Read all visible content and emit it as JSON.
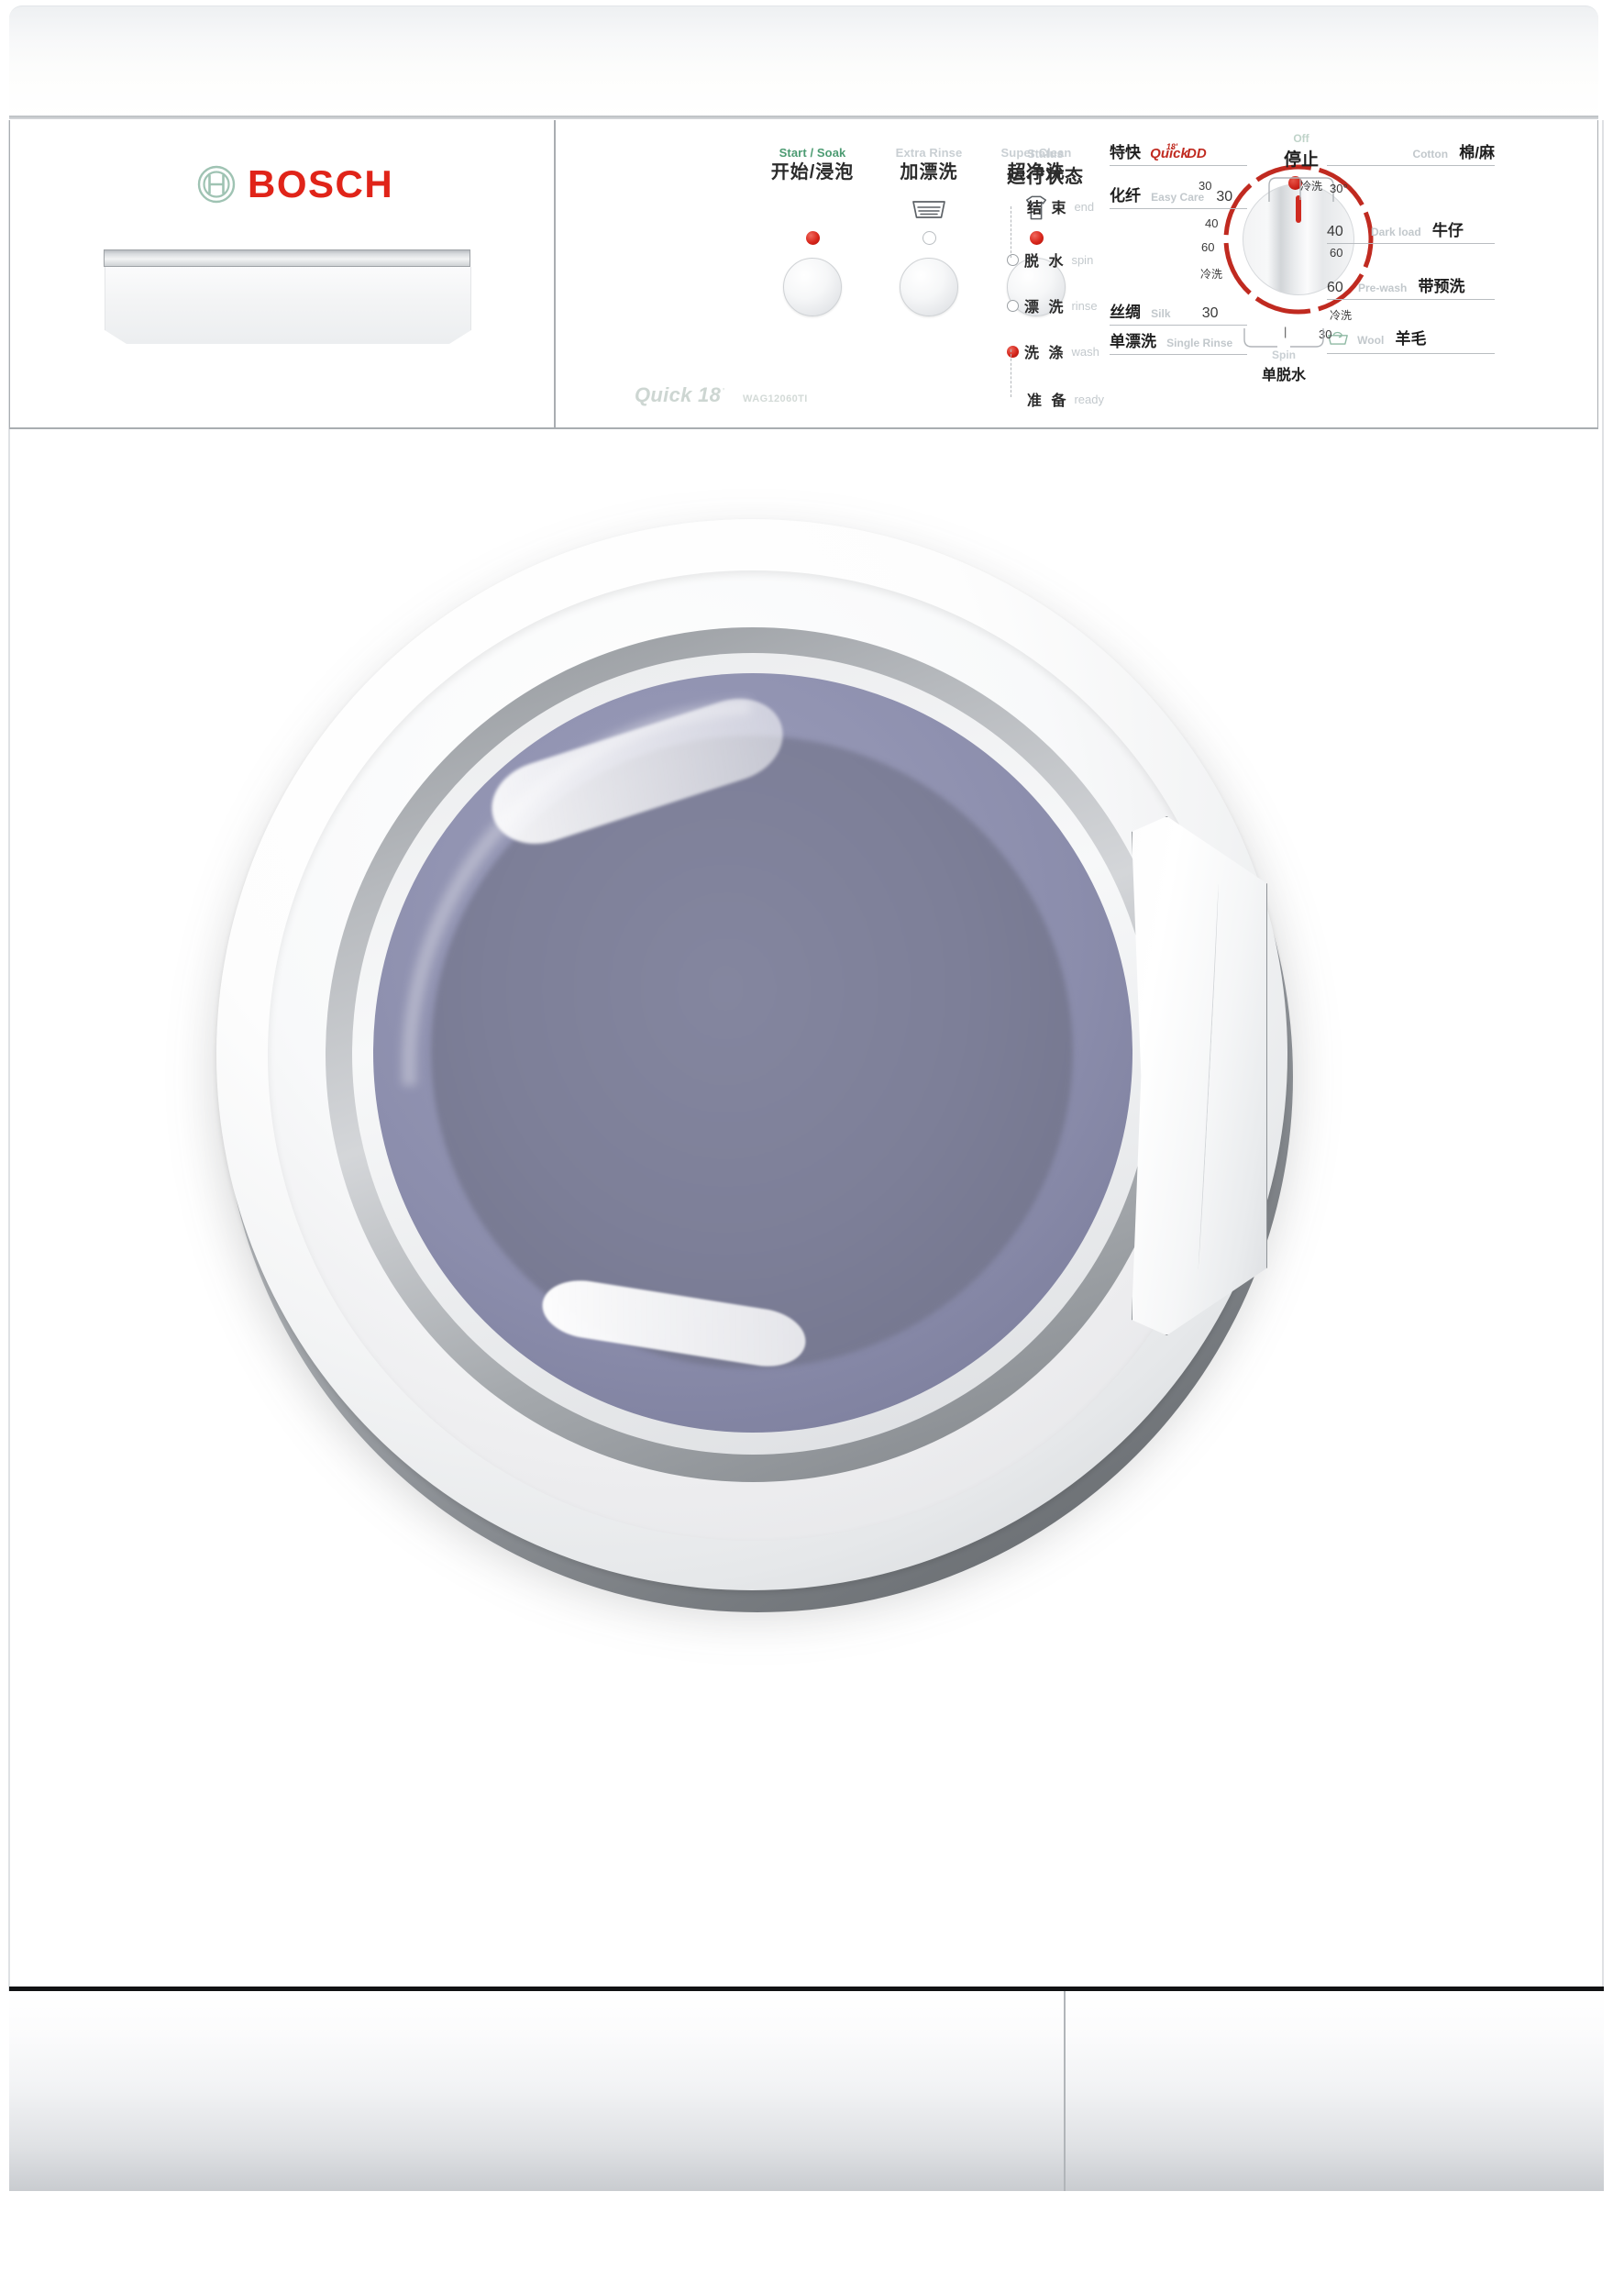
{
  "brand": {
    "name": "BOSCH",
    "logo_icon": "bosch-armature-icon",
    "logo_color": "#e02419",
    "mark_color": "#9fc3b3"
  },
  "model": {
    "series": "Quick 18",
    "series_superscript": "'",
    "code": "WAG12060TI"
  },
  "buttons": [
    {
      "en": "Start / Soak",
      "cn": "开始/浸泡",
      "en_color": "#4c9b72",
      "icon": "none",
      "led_state": "on"
    },
    {
      "en": "Extra Rinse",
      "cn": "加漂洗",
      "en_color": "#c9cfd3",
      "icon": "wash-tub-icon",
      "led_state": "off"
    },
    {
      "en": "Super Clean",
      "cn": "超净洗",
      "en_color": "#c9cfd3",
      "icon": "tshirt-icon",
      "led_state": "on"
    }
  ],
  "status": {
    "en": "Status",
    "cn": "运行状态",
    "items": [
      {
        "cn": "结 束",
        "en": "end",
        "state": "bracket-top"
      },
      {
        "cn": "脱 水",
        "en": "spin",
        "state": "off"
      },
      {
        "cn": "漂 洗",
        "en": "rinse",
        "state": "off"
      },
      {
        "cn": "洗 涤",
        "en": "wash",
        "state": "on"
      },
      {
        "cn": "准 备",
        "en": "ready",
        "state": "bracket-bottom"
      }
    ]
  },
  "dial": {
    "off": {
      "en": "Off",
      "cn": "停止"
    },
    "spin": {
      "en": "Spin",
      "cn": "单脱水",
      "tick": "|"
    },
    "pointer_color": "#cf2b21",
    "left_programs": [
      {
        "cn": "特快",
        "en": "Quick",
        "badge": "18'",
        "arrow": "DD",
        "ruled": true
      },
      {
        "cn": "化纤",
        "en": "Easy Care",
        "temp": "30",
        "ruled": true
      },
      {
        "cn": "丝绸",
        "en": "Silk",
        "temp": "30",
        "ruled": true
      },
      {
        "cn": "单漂洗",
        "en": "Single Rinse",
        "temp": "",
        "ruled": true
      }
    ],
    "left_temps": [
      "30",
      "40",
      "60",
      "冷洗"
    ],
    "left_inner_tick": "30",
    "right_programs": [
      {
        "cn": "棉/麻",
        "en": "Cotton",
        "temp": "",
        "ruled": true
      },
      {
        "cn": "牛仔",
        "en": "Dark load",
        "temp": "40",
        "ruled": true
      },
      {
        "cn": "带预洗",
        "en": "Pre-wash",
        "temp": "60",
        "ruled": true
      },
      {
        "cn": "羊毛",
        "en": "Wool",
        "temp": "",
        "icon": "wool-basin-icon",
        "ruled": true
      }
    ],
    "right_temps": [
      "冷洗",
      "30°",
      "60",
      "冷洗",
      "30"
    ]
  },
  "colors": {
    "glass": "#8b8dac",
    "led_on": "#d3241a",
    "dial_arc": "#c02a20",
    "wool_icon": "#8fb9a4",
    "panel_border": "#a9adb1"
  }
}
